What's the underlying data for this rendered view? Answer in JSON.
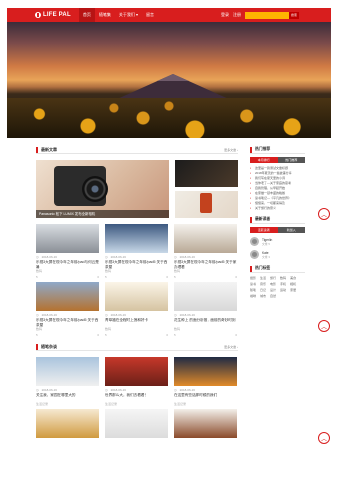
{
  "header": {
    "logo": "LIFE PAL",
    "nav": [
      "首页",
      "随笔集",
      "关于我们 ▾",
      "留言"
    ],
    "links": [
      "登录",
      "注册"
    ],
    "search_placeholder": "",
    "search_button": "搜索"
  },
  "banner": {
    "dots": 3
  },
  "main": {
    "section1": {
      "title": "最新文章",
      "more": "更多文章 ›"
    },
    "big_caption": "Panasonic 松下 LUMIX 发布全新相机",
    "posts": [
      {
        "date": "2018-06-16",
        "title": "乐视3大屏在现今年之年前/pad与何云是暑",
        "sub": "数码",
        "views": "5",
        "likes": "0"
      },
      {
        "date": "2018-06-16",
        "title": "乐视3大屏在现今年之年前/pad5 关于西茶屋",
        "sub": "数码",
        "views": "5",
        "likes": "0"
      },
      {
        "date": "2018-06-16",
        "title": "乐视3大屏在现今年之年前/pad5 关于家办理看 ",
        "sub": "数码",
        "views": "5",
        "likes": "0"
      },
      {
        "date": "2018-06-16",
        "title": "乐视3大屏在现今年之年前/pad5 关于西茶屋",
        "sub": "数码",
        "views": "5",
        "likes": "0"
      },
      {
        "date": "2018-06-16",
        "title": "青萃福在全程时上莲和好卡",
        "sub": "数码",
        "views": "5",
        "likes": "0"
      },
      {
        "date": "2018-06-16",
        "title": "花生种上 的面分析推 , 面前的奇妙时刻",
        "sub": "数码",
        "views": "5",
        "likes": "0"
      }
    ],
    "section2": {
      "title": "随笔杂谈",
      "more": "更多文章 ›"
    },
    "posts2": [
      {
        "date": "2018-06-16",
        "title": "关注我，家园在哪里大的",
        "sub": "生活记录",
        "views": "5",
        "likes": "0"
      },
      {
        "date": "2018-06-16",
        "title": "世界那么大，我们去看看！",
        "sub": "生活记录",
        "views": "5",
        "likes": "0"
      },
      {
        "date": "2018-06-16",
        "title": "在这里有些话那时候的我们",
        "sub": "生活记录",
        "views": "5",
        "likes": "0"
      }
    ]
  },
  "sidebar": {
    "hot": {
      "title": "热门推荐",
      "tabs": [
        "本月排行",
        "热门推荐"
      ],
      "items": [
        "这里是一篇测试文章标题",
        "2018年夏天的一些故事分享",
        "我们写在夏天里的小诗",
        "当你老了—关于家庭的思考",
        "自我管理，从早起开始",
        "在家做一顿丰盛的晚餐",
        "读书笔记—《平凡的世界》",
        "慢慢来，一切都来得及",
        "关于旅行的意义"
      ]
    },
    "readers": {
      "title": "最新读者",
      "tabs": [
        "活跃读者",
        "新加入"
      ],
      "users": [
        {
          "name": "Tigerlin",
          "stat": "文章 5"
        },
        {
          "name": "Kate",
          "stat": "文章 3"
        }
      ]
    },
    "tags": {
      "title": "热门标签",
      "items": [
        "摄影",
        "生活",
        "旅行",
        "数码",
        "美食",
        "读书",
        "音乐",
        "电影",
        "手机",
        "相机",
        "随笔",
        "日记",
        "设计",
        "运动",
        "家居",
        "咖啡",
        "城市",
        "自然"
      ]
    }
  }
}
